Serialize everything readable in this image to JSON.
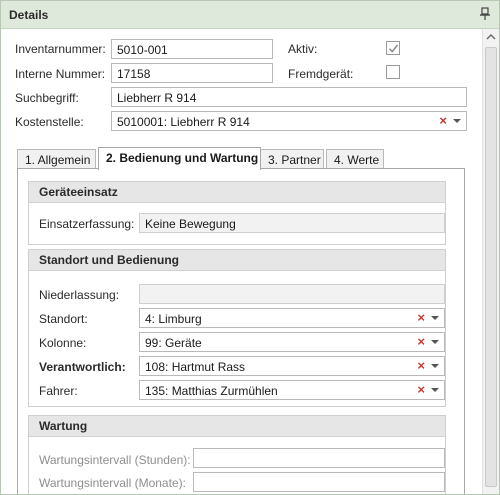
{
  "panel": {
    "title": "Details"
  },
  "header_fields": {
    "inventarnummer": {
      "label": "Inventarnummer:",
      "value": "5010-001"
    },
    "interne_nummer": {
      "label": "Interne Nummer:",
      "value": "17158"
    },
    "aktiv": {
      "label": "Aktiv:",
      "checked": true
    },
    "fremdgeraet": {
      "label": "Fremdgerät:",
      "checked": false
    },
    "suchbegriff": {
      "label": "Suchbegriff:",
      "value": "Liebherr R 914"
    },
    "kostenstelle": {
      "label": "Kostenstelle:",
      "value": "5010001: Liebherr R 914"
    }
  },
  "tabs": [
    {
      "label": "1. Allgemein",
      "active": false
    },
    {
      "label": "2. Bedienung und Wartung",
      "active": true
    },
    {
      "label": "3. Partner",
      "active": false
    },
    {
      "label": "4. Werte",
      "active": false
    }
  ],
  "groups": {
    "geraeteeinsatz": {
      "title": "Geräteeinsatz",
      "einsatzerfassung": {
        "label": "Einsatzerfassung:",
        "value": "Keine Bewegung"
      }
    },
    "standort": {
      "title": "Standort und Bedienung",
      "niederlassung": {
        "label": "Niederlassung:",
        "value": ""
      },
      "standort": {
        "label": "Standort:",
        "value": "4: Limburg"
      },
      "kolonne": {
        "label": "Kolonne:",
        "value": "99: Geräte"
      },
      "verantwortlich": {
        "label": "Verantwortlich:",
        "value": "108: Hartmut Rass"
      },
      "fahrer": {
        "label": "Fahrer:",
        "value": "135: Matthias Zurmühlen"
      }
    },
    "wartung": {
      "title": "Wartung",
      "intervall_stunden": {
        "label": "Wartungsintervall (Stunden):",
        "value": ""
      },
      "intervall_monate": {
        "label": "Wartungsintervall (Monate):",
        "value": ""
      }
    }
  },
  "icons": {
    "pin": "pin-icon",
    "clear": "clear-x-icon",
    "dropdown": "chevron-down-icon",
    "check": "check-icon"
  },
  "clear_glyph": "×",
  "colors": {
    "header_bg": "#dfe9db",
    "clear_x": "#c0392b",
    "group_header": "#e6e6e6"
  }
}
